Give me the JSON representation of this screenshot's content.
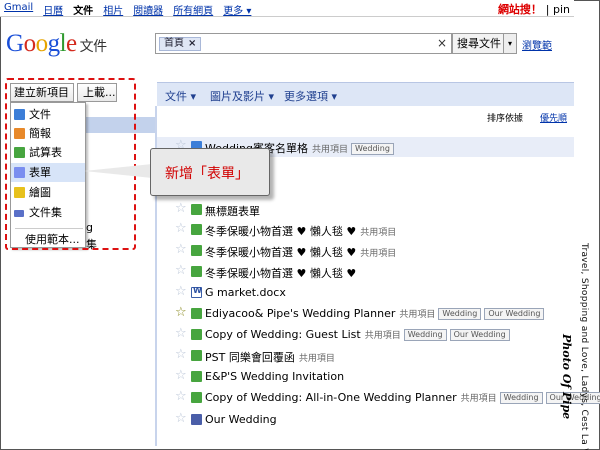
{
  "topbar": {
    "nav": [
      "Gmail",
      "日曆",
      "文件",
      "相片",
      "閱讀器",
      "所有網頁",
      "更多 ▾"
    ],
    "active_index": 2,
    "right_text": "網站搜！",
    "right_sep": "| pin"
  },
  "logo": {
    "google": "Google",
    "docs": "文件"
  },
  "search": {
    "chip": "首頁",
    "chip_close": "×",
    "clear": "×",
    "button": "搜尋文件",
    "dropdown": "▾",
    "browse": "瀏覽範"
  },
  "toolbar": {
    "items": [
      "文件 ▾",
      "圖片及影片 ▾",
      "更多選項 ▾"
    ]
  },
  "sort": {
    "label": "排序依據",
    "value": "優先順"
  },
  "left": {
    "create": "建立新項目 ▾",
    "upload": "上載...",
    "snip1": "g",
    "snip2": "集"
  },
  "menu": {
    "items": [
      {
        "label": "文件",
        "icon": "doc-icon"
      },
      {
        "label": "簡報",
        "icon": "presentation-icon"
      },
      {
        "label": "試算表",
        "icon": "spreadsheet-icon"
      },
      {
        "label": "表單",
        "icon": "form-icon"
      },
      {
        "label": "繪圖",
        "icon": "drawing-icon"
      },
      {
        "label": "文件集",
        "icon": "collection-icon"
      },
      {
        "label": "使用範本...",
        "icon": ""
      }
    ],
    "highlight_index": 3
  },
  "callout": {
    "text": "新增「表單」"
  },
  "files": [
    {
      "name": "Wedding賓客名單格",
      "icon": "doc",
      "shared": "共用項目",
      "tags": [
        "Wedding"
      ],
      "starred": false
    },
    {
      "name": "無標題表單",
      "icon": "form",
      "shared": "",
      "tags": [],
      "starred": false
    },
    {
      "name": "冬季保暖小物首選 ♥ 懶人毯 ♥",
      "icon": "form",
      "shared": "共用項目",
      "tags": [],
      "starred": false
    },
    {
      "name": "冬季保暖小物首選 ♥ 懶人毯 ♥",
      "icon": "form",
      "shared": "共用項目",
      "tags": [],
      "starred": false
    },
    {
      "name": "冬季保暖小物首選 ♥ 懶人毯 ♥",
      "icon": "form",
      "shared": "",
      "tags": [],
      "starred": false
    },
    {
      "name": "G market.docx",
      "icon": "word",
      "shared": "",
      "tags": [],
      "starred": false
    },
    {
      "name": "Ediyacoo& Pipe's Wedding Planner",
      "icon": "form",
      "shared": "共用項目",
      "tags": [
        "Wedding",
        "Our Wedding"
      ],
      "starred": true
    },
    {
      "name": "Copy of Wedding: Guest List",
      "icon": "form",
      "shared": "共用項目",
      "tags": [
        "Wedding",
        "Our Wedding"
      ],
      "starred": false
    },
    {
      "name": "PST 同樂會回覆函",
      "icon": "form",
      "shared": "共用項目",
      "tags": [],
      "starred": false
    },
    {
      "name": "E&P'S Wedding Invitation",
      "icon": "form",
      "shared": "",
      "tags": [],
      "starred": false
    },
    {
      "name": "Copy of Wedding: All-in-One Wedding Planner",
      "icon": "form",
      "shared": "共用項目",
      "tags": [
        "Wedding",
        "Our Wedding"
      ],
      "starred": false
    },
    {
      "name": "Our Wedding",
      "icon": "col",
      "shared": "",
      "tags": [],
      "starred": false
    }
  ],
  "watermark": {
    "vertical": "Travel, Shopping and Love, Ladys, Cest La Vie!",
    "signature": "Photo Of Pipe"
  },
  "colors": {
    "accent": "#1a4fd8",
    "callout_text": "#d10000",
    "dashed_box": "#dd1111",
    "toolbar_bg": "#dde6f6"
  }
}
